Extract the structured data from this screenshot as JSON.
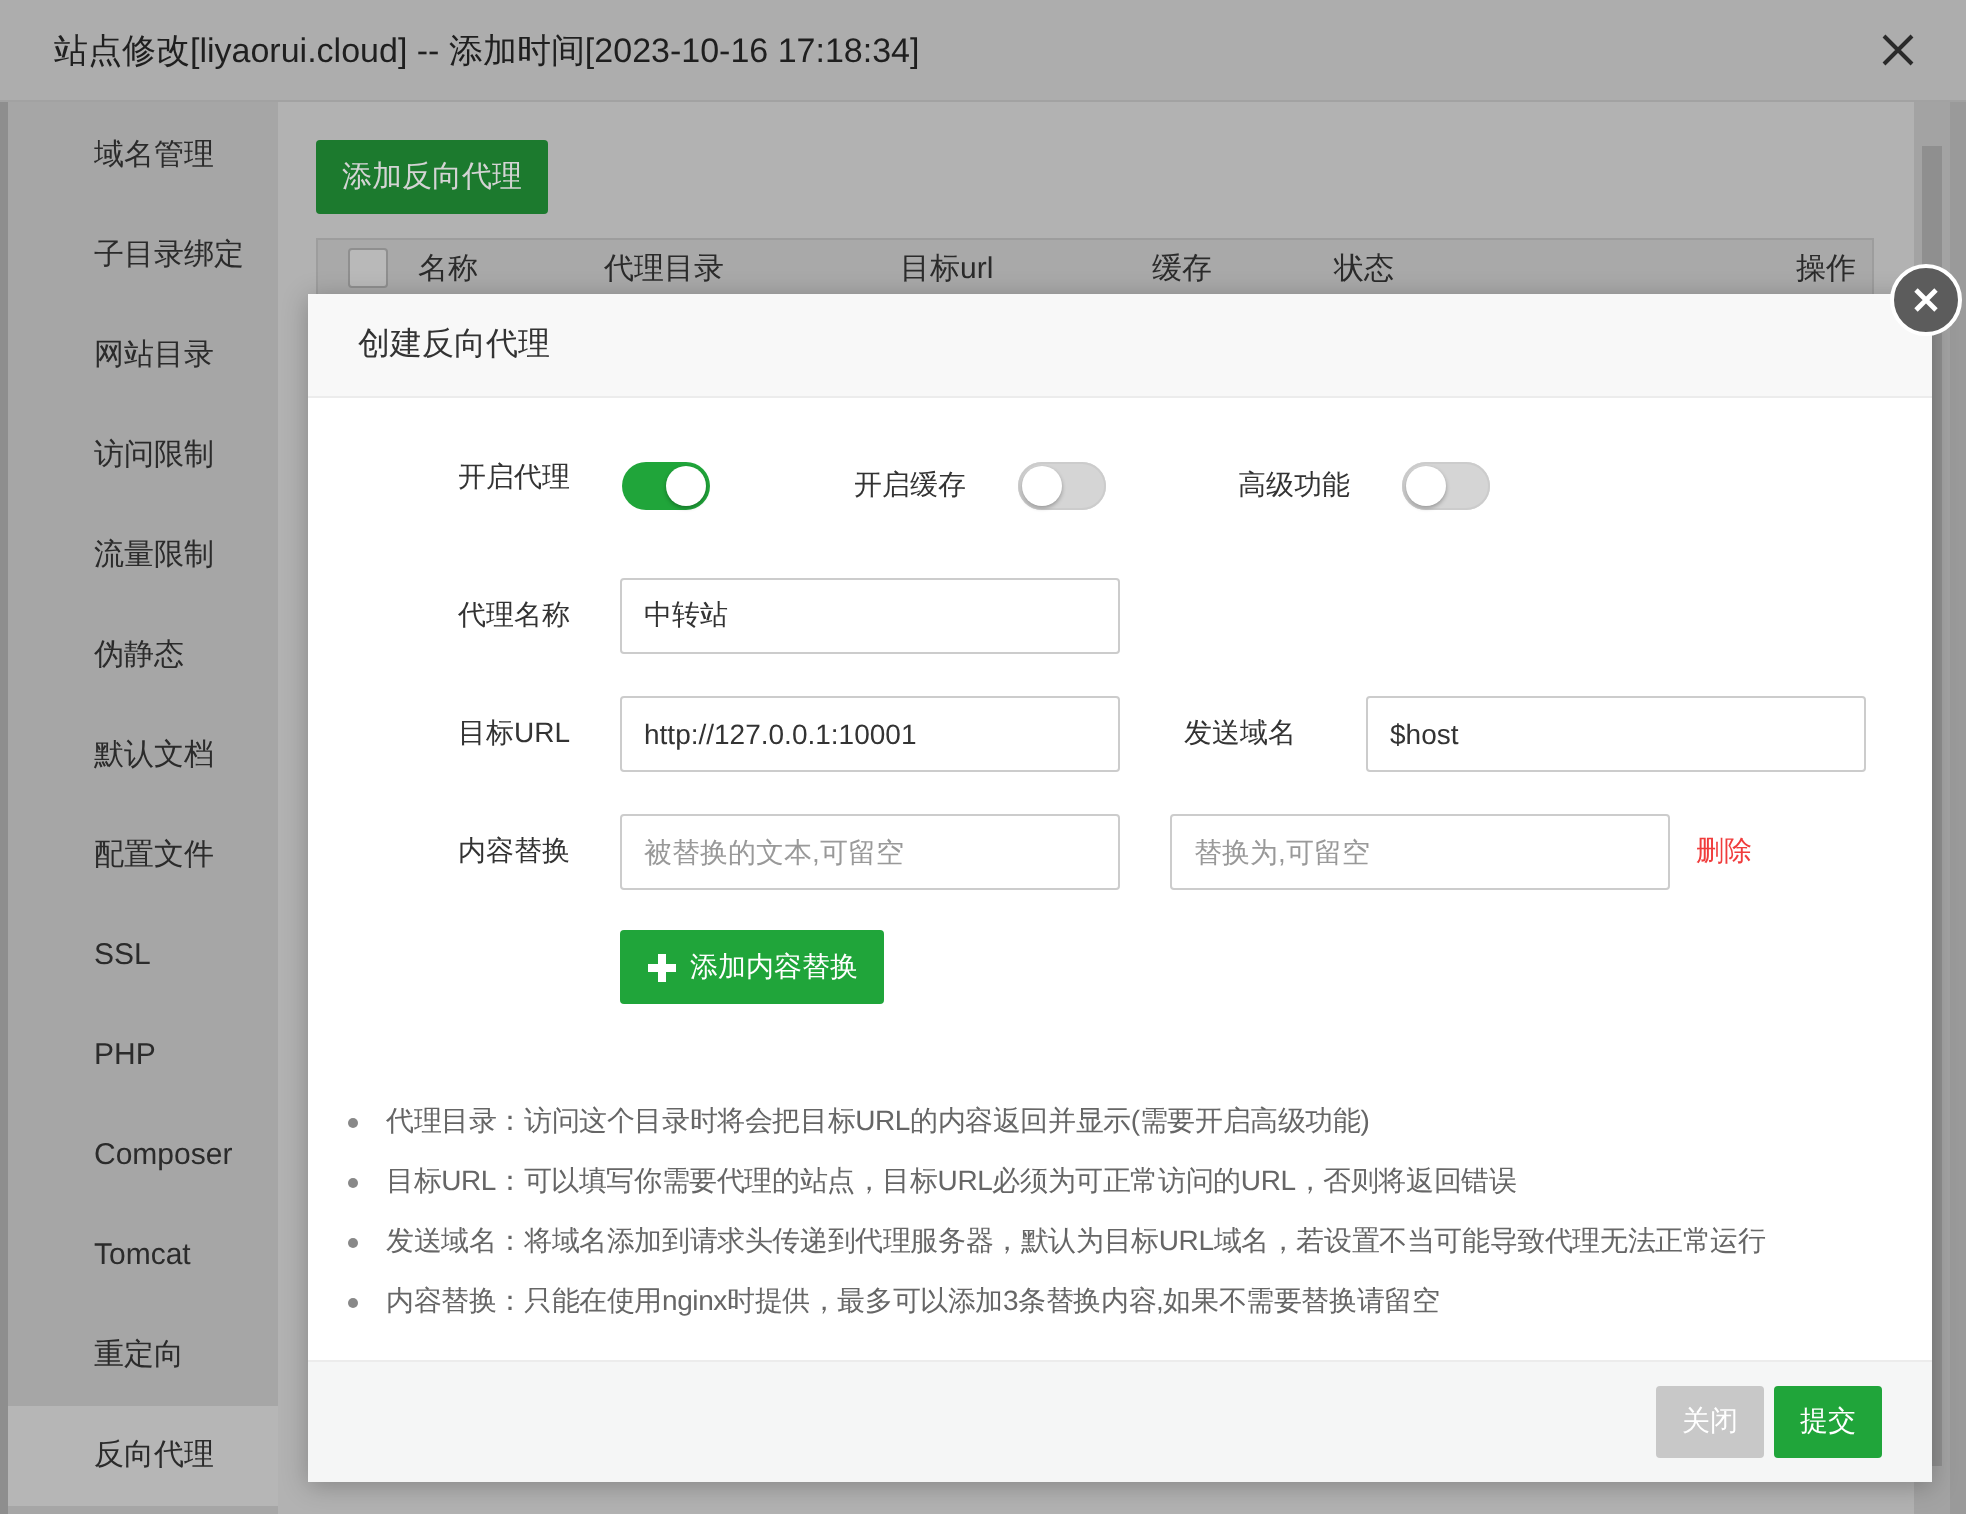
{
  "window": {
    "title": "站点修改[liyaorui.cloud] -- 添加时间[2023-10-16 17:18:34]"
  },
  "sidebar": {
    "items": [
      {
        "label": "域名管理",
        "selected": false
      },
      {
        "label": "子目录绑定",
        "selected": false
      },
      {
        "label": "网站目录",
        "selected": false
      },
      {
        "label": "访问限制",
        "selected": false
      },
      {
        "label": "流量限制",
        "selected": false
      },
      {
        "label": "伪静态",
        "selected": false
      },
      {
        "label": "默认文档",
        "selected": false
      },
      {
        "label": "配置文件",
        "selected": false
      },
      {
        "label": "SSL",
        "selected": false
      },
      {
        "label": "PHP",
        "selected": false
      },
      {
        "label": "Composer",
        "selected": false
      },
      {
        "label": "Tomcat",
        "selected": false
      },
      {
        "label": "重定向",
        "selected": false
      },
      {
        "label": "反向代理",
        "selected": true
      }
    ]
  },
  "toolbar": {
    "add_button": "添加反向代理"
  },
  "table": {
    "select_all": {
      "checked": false
    },
    "columns": [
      "名称",
      "代理目录",
      "目标url",
      "缓存",
      "状态",
      "操作"
    ]
  },
  "dialog": {
    "title": "创建反向代理",
    "toggles": [
      {
        "label": "开启代理",
        "on": true
      },
      {
        "label": "开启缓存",
        "on": false
      },
      {
        "label": "高级功能",
        "on": false
      }
    ],
    "name_field": {
      "label": "代理名称",
      "value": "中转站"
    },
    "target_field": {
      "label": "目标URL",
      "value": "http://127.0.0.1:10001"
    },
    "host_field": {
      "label": "发送域名",
      "value": "$host"
    },
    "replace": {
      "label": "内容替换",
      "inputs": [
        {
          "placeholder": "被替换的文本,可留空"
        },
        {
          "placeholder": "替换为,可留空"
        }
      ],
      "delete": "删除"
    },
    "add_replace_button": "添加内容替换",
    "notes": [
      "代理目录：访问这个目录时将会把目标URL的内容返回并显示(需要开启高级功能)",
      "目标URL：可以填写你需要代理的站点，目标URL必须为可正常访问的URL，否则将返回错误",
      "发送域名：将域名添加到请求头传递到代理服务器，默认为目标URL域名，若设置不当可能导致代理无法正常运行",
      "内容替换：只能在使用nginx时提供，最多可以添加3条替换内容,如果不需要替换请留空"
    ],
    "buttons": [
      {
        "label": "关闭",
        "kind": "secondary"
      },
      {
        "label": "提交",
        "kind": "primary"
      }
    ]
  }
}
